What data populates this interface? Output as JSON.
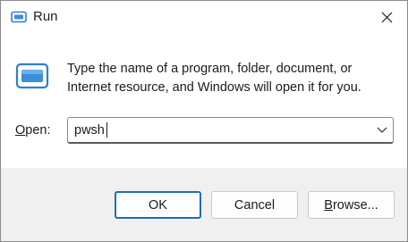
{
  "window": {
    "title": "Run"
  },
  "dialog": {
    "description": "Type the name of a program, folder, document, or Internet resource, and Windows will open it for you.",
    "open_label_accel": "O",
    "open_label_rest": "pen:",
    "open_value": "pwsh"
  },
  "buttons": {
    "ok": "OK",
    "cancel": "Cancel",
    "browse_accel": "B",
    "browse_rest": "rowse..."
  },
  "colors": {
    "accent": "#1f6fb5",
    "icon_blue": "#3a8fd8"
  },
  "icons": {
    "title": "run-icon",
    "dialog": "run-icon",
    "close": "close-icon",
    "dropdown": "chevron-down-icon"
  }
}
